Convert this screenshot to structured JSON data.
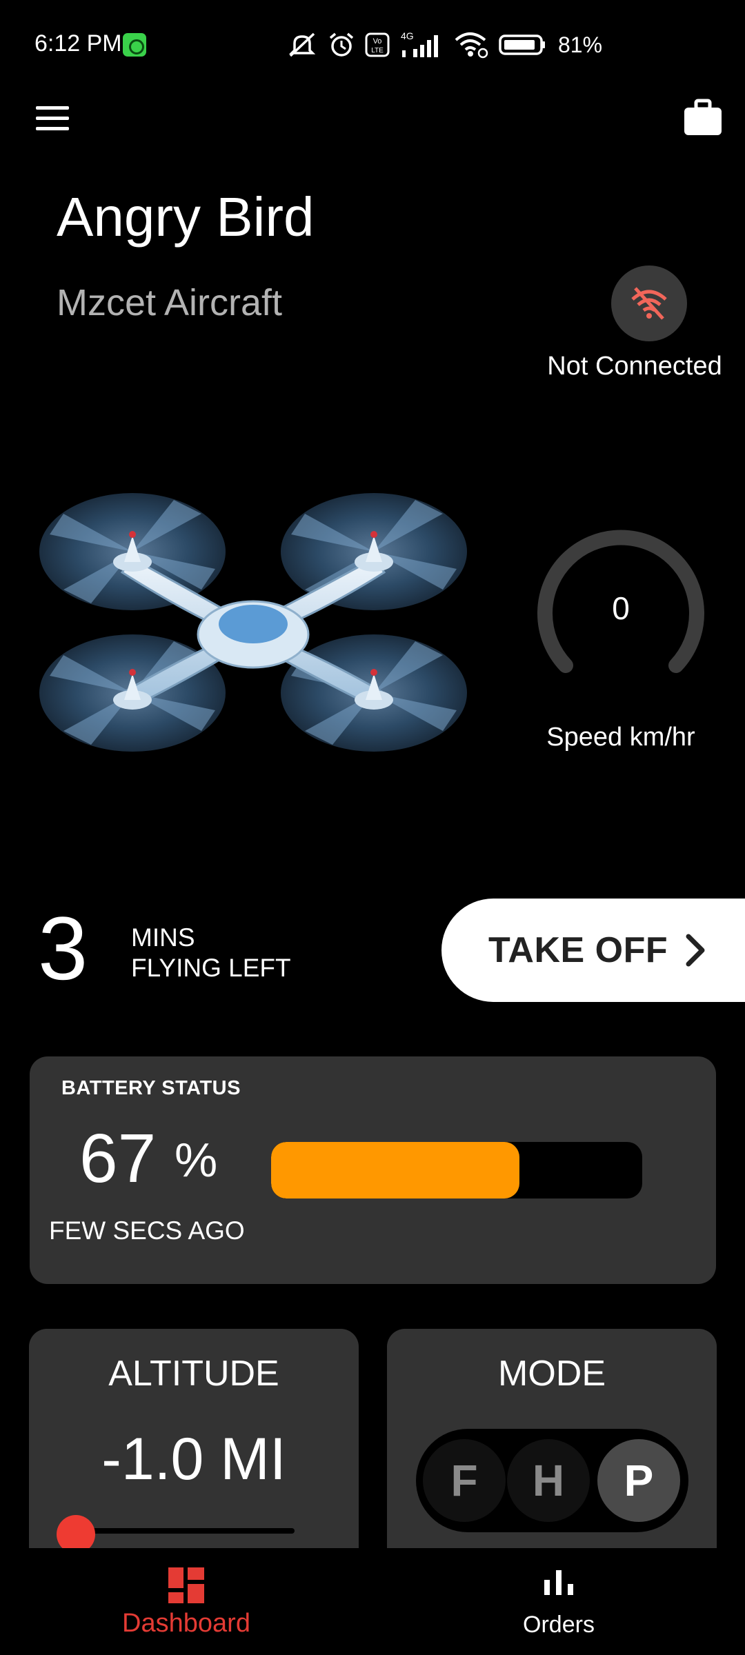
{
  "status_bar": {
    "time": "6:12 PM",
    "battery_percent": "81%",
    "network": "4G",
    "icons": [
      "app-notification-icon",
      "silent-icon",
      "alarm-icon",
      "volte-icon",
      "signal-icon",
      "wifi-icon",
      "battery-icon"
    ]
  },
  "header": {
    "menu_icon": "hamburger-menu-icon",
    "briefcase_icon": "briefcase-icon"
  },
  "aircraft": {
    "name": "Angry Bird",
    "type": "Mzcet Aircraft"
  },
  "connection": {
    "status": "Not Connected",
    "icon": "wifi-off-icon",
    "color": "#f2665a"
  },
  "speed": {
    "value": "0",
    "label": "Speed km/hr"
  },
  "flight": {
    "minutes": "3",
    "label_line1": "MINS",
    "label_line2": "FLYING LEFT",
    "takeoff_label": "TAKE OFF"
  },
  "battery": {
    "title": "BATTERY STATUS",
    "value": "67",
    "unit": "%",
    "updated": "FEW SECS AGO",
    "level": 0.67,
    "color": "#ff9800"
  },
  "altitude": {
    "title": "ALTITUDE",
    "value": "-1.0 MI",
    "slider_level": 0
  },
  "mode": {
    "title": "MODE",
    "options": [
      "F",
      "H",
      "P"
    ],
    "selected": "P"
  },
  "bottom_nav": {
    "items": [
      {
        "label": "Dashboard",
        "icon": "dashboard-icon",
        "active": true
      },
      {
        "label": "Orders",
        "icon": "bar-chart-icon",
        "active": false
      }
    ],
    "active_color": "#e43b34"
  }
}
